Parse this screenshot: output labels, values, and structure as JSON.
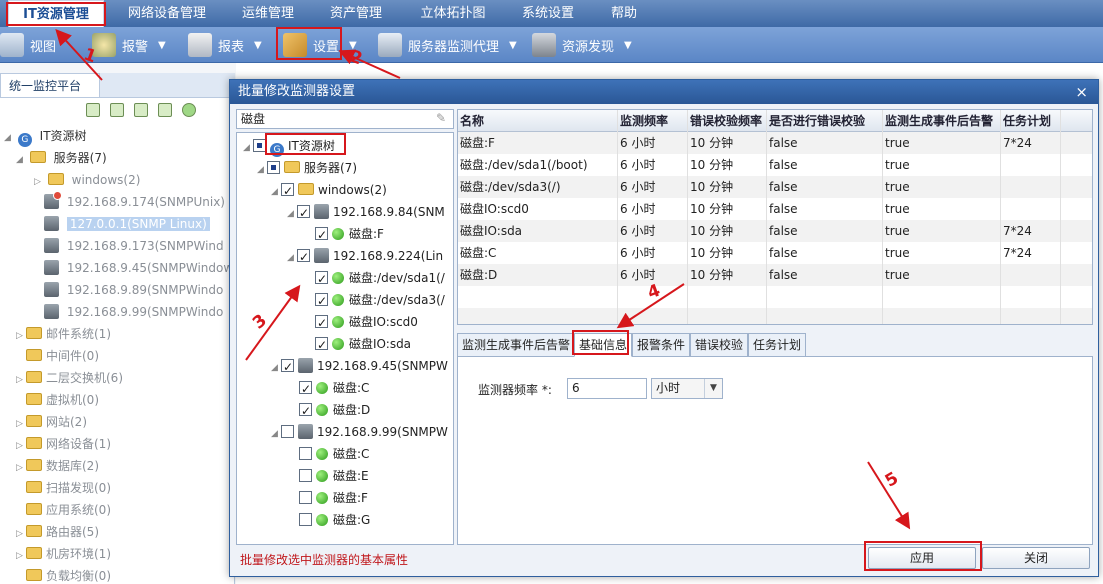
{
  "menubar": {
    "items": [
      "IT资源管理",
      "网络设备管理",
      "运维管理",
      "资产管理",
      "立体拓扑图",
      "系统设置",
      "帮助"
    ]
  },
  "toolbar": {
    "items": [
      "视图",
      "报警",
      "报表",
      "设置",
      "服务器监测代理",
      "资源发现"
    ]
  },
  "left_panel": {
    "tab": "统一监控平台",
    "tree": {
      "root": "IT资源树",
      "servers": "服务器(7)",
      "windows": "windows(2)",
      "nodes": [
        "192.168.9.174(SNMPUnix)",
        "127.0.0.1(SNMP Linux)",
        "192.168.9.173(SNMPWind",
        "192.168.9.45(SNMPWindow",
        "192.168.9.89(SNMPWindo",
        "192.168.9.99(SNMPWindo"
      ],
      "groups": [
        "邮件系统(1)",
        "中间件(0)",
        "二层交换机(6)",
        "虚拟机(0)",
        "网站(2)",
        "网络设备(1)",
        "数据库(2)",
        "扫描发现(0)",
        "应用系统(0)",
        "路由器(5)",
        "机房环境(1)",
        "负载均衡(0)"
      ]
    }
  },
  "dialog": {
    "title": "批量修改监测器设置",
    "search_value": "磁盘",
    "tree": {
      "root": "IT资源树",
      "servers": "服务器(7)",
      "windows": "windows(2)",
      "host1": "192.168.9.84(SNM",
      "host1_disks": [
        "磁盘:F"
      ],
      "host2": "192.168.9.224(Lin",
      "host2_disks": [
        "磁盘:/dev/sda1(/",
        "磁盘:/dev/sda3(/",
        "磁盘IO:scd0",
        "磁盘IO:sda"
      ],
      "host3": "192.168.9.45(SNMPW",
      "host3_disks": [
        "磁盘:C",
        "磁盘:D"
      ],
      "host4": "192.168.9.99(SNMPW",
      "host4_disks": [
        "磁盘:C",
        "磁盘:E",
        "磁盘:F",
        "磁盘:G"
      ]
    },
    "grid": {
      "columns": [
        "名称",
        "监测频率",
        "错误校验频率",
        "是否进行错误校验",
        "监测生成事件后告警",
        "任务计划"
      ],
      "rows": [
        [
          "磁盘:F",
          "6 小时",
          "10 分钟",
          "false",
          "true",
          "7*24"
        ],
        [
          "磁盘:/dev/sda1(/boot)",
          "6 小时",
          "10 分钟",
          "false",
          "true",
          ""
        ],
        [
          "磁盘:/dev/sda3(/)",
          "6 小时",
          "10 分钟",
          "false",
          "true",
          ""
        ],
        [
          "磁盘IO:scd0",
          "6 小时",
          "10 分钟",
          "false",
          "true",
          ""
        ],
        [
          "磁盘IO:sda",
          "6 小时",
          "10 分钟",
          "false",
          "true",
          "7*24"
        ],
        [
          "磁盘:C",
          "6 小时",
          "10 分钟",
          "false",
          "true",
          "7*24"
        ],
        [
          "磁盘:D",
          "6 小时",
          "10 分钟",
          "false",
          "true",
          ""
        ]
      ]
    },
    "tabs": [
      "监测生成事件后告警",
      "基础信息",
      "报警条件",
      "错误校验",
      "任务计划"
    ],
    "form": {
      "freq_label": "监测器频率 *:",
      "freq_value": "6",
      "unit_value": "小时"
    },
    "hint": "批量修改选中监测器的基本属性",
    "apply_label": "应用",
    "close_label": "关闭",
    "close_icon": "×"
  },
  "annotations": [
    "1",
    "2",
    "3",
    "4",
    "5"
  ],
  "colors": {
    "annotation": "#d6171c",
    "title_bar": "#2a5796",
    "hint": "#c0171b"
  }
}
